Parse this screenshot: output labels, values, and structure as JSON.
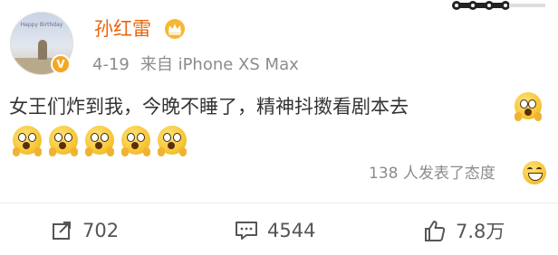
{
  "post": {
    "username": "孙红雷",
    "date": "4-19",
    "source": "来自 iPhone XS Max",
    "avatar_caption": "Happy Birthday",
    "text": "女王们炸到我，今晚不睡了，精神抖擞看剧本去",
    "inline_emoji": "scream-emoji",
    "emoji_row": [
      "scream-emoji",
      "scream-emoji",
      "scream-emoji",
      "scream-emoji",
      "scream-emoji"
    ],
    "reactions_text": "138 人发表了态度",
    "reactions_emoji": "grin-emoji"
  },
  "actions": {
    "repost_count": "702",
    "comment_count": "4544",
    "like_count": "7.8万"
  },
  "colors": {
    "username": "#e8650d",
    "vip_badge": "#f5a623",
    "meta_text": "#8c8c8c",
    "body_text": "#333333"
  },
  "icons": {
    "vip": "vip-crown-icon",
    "verified": "verified-v-icon",
    "repost": "repost-icon",
    "comment": "comment-icon",
    "like": "thumbs-up-icon"
  }
}
